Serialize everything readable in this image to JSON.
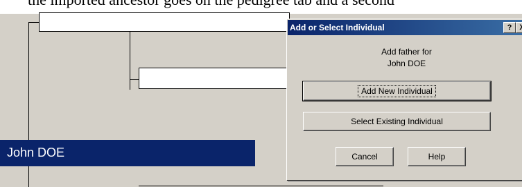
{
  "background_caption": "the imported ancestor goes on the pedigree tab and a second",
  "pedigree": {
    "selected_person": "John DOE"
  },
  "dialog": {
    "title": "Add or Select Individual",
    "help_glyph": "?",
    "close_glyph": "X",
    "message_line1": "Add father for",
    "message_line2": "John DOE",
    "add_new_label": "Add New Individual",
    "select_existing_label": "Select Existing Individual",
    "cancel_label": "Cancel",
    "help_label": "Help"
  },
  "colors": {
    "selection": "#0a246a",
    "dialog_face": "#d4d0c8",
    "titlebar_start": "#0a246a",
    "titlebar_end": "#3a6ea5"
  }
}
